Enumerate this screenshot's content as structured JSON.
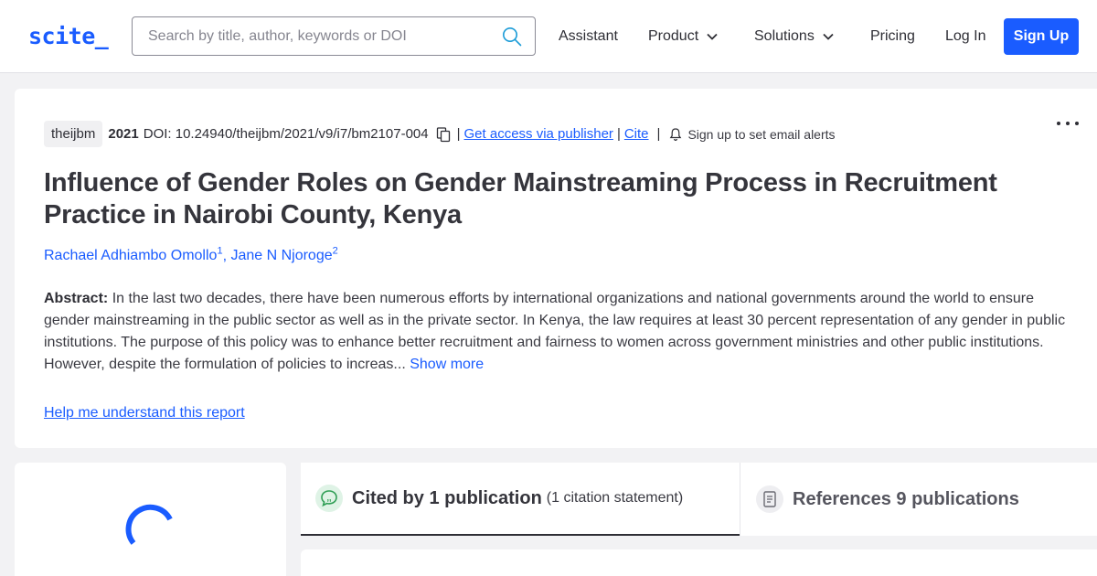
{
  "colors": {
    "accent": "#1a5cff",
    "text": "#2e2e35",
    "background": "#f2f2f4"
  },
  "header": {
    "logo": "scite_",
    "search_placeholder": "Search by title, author, keywords or DOI",
    "nav": {
      "assistant": "Assistant",
      "product": "Product",
      "solutions": "Solutions",
      "pricing": "Pricing",
      "login": "Log In",
      "signup": "Sign Up"
    }
  },
  "article": {
    "journal": "theijbm",
    "year": "2021",
    "doi": "DOI: 10.24940/theijbm/2021/v9/i7/bm2107-004",
    "access_link": "Get access via publisher",
    "cite_link": "Cite",
    "alert_text": "Sign up to set email alerts",
    "title": "Influence of Gender Roles on Gender Mainstreaming Process in Recruitment Practice in Nairobi County, Kenya",
    "authors": [
      {
        "name": "Rachael Adhiambo Omollo",
        "sup": "1"
      },
      {
        "name": "Jane N Njoroge",
        "sup": "2"
      }
    ],
    "abstract_label": "Abstract:",
    "abstract_text": "In the last two decades, there have been numerous efforts by international organizations and national governments around the world to ensure gender mainstreaming in the public sector as well as in the private sector. In Kenya, the law requires at least 30 percent representation of any gender in public institutions. The purpose of this policy was to enhance better recruitment and fairness to women across government ministries and other public institutions. However, despite the formulation of policies to increas...",
    "show_more": "Show more",
    "help_link": "Help me understand this report"
  },
  "tabs": {
    "cited": {
      "label": "Cited by 1 publication",
      "sub": "(1 citation statement)",
      "icon": "quote-bubble-icon"
    },
    "references": {
      "label": "References 9 publications",
      "icon": "document-icon"
    }
  }
}
